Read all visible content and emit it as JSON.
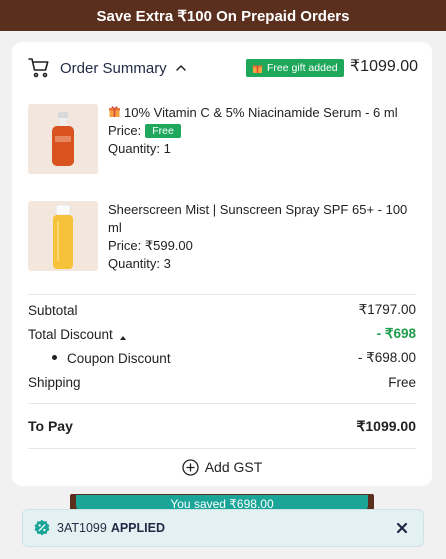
{
  "banner": {
    "text": "Save Extra ₹100 On Prepaid Orders"
  },
  "summary": {
    "title": "Order Summary",
    "gift_badge": "Free gift added",
    "total": "₹1099.00"
  },
  "items": [
    {
      "name": "10% Vitamin C & 5% Niacinamide Serum - 6 ml",
      "price_label": "Price:",
      "price_value": "Free",
      "quantity": "Quantity: 1"
    },
    {
      "name": "Sheerscreen Mist | Sunscreen Spray SPF 65+ - 100 ml",
      "price": "Price: ₹599.00",
      "quantity": "Quantity: 3"
    }
  ],
  "breakdown": {
    "subtotal_label": "Subtotal",
    "subtotal_value": "₹1797.00",
    "discount_label": "Total Discount",
    "discount_value": "- ₹698",
    "coupon_label": "Coupon Discount",
    "coupon_value": "- ₹698.00",
    "shipping_label": "Shipping",
    "shipping_value": "Free",
    "topay_label": "To Pay",
    "topay_value": "₹1099.00"
  },
  "gst": {
    "label": "Add GST"
  },
  "savings": {
    "text": "You saved ₹698.00"
  },
  "coupon": {
    "code": "3AT1099",
    "status": "APPLIED"
  },
  "colors": {
    "banner": "#5a2f1e",
    "green": "#1fa85b",
    "teal": "#1aa598",
    "discount_text": "#1f9b4c"
  }
}
